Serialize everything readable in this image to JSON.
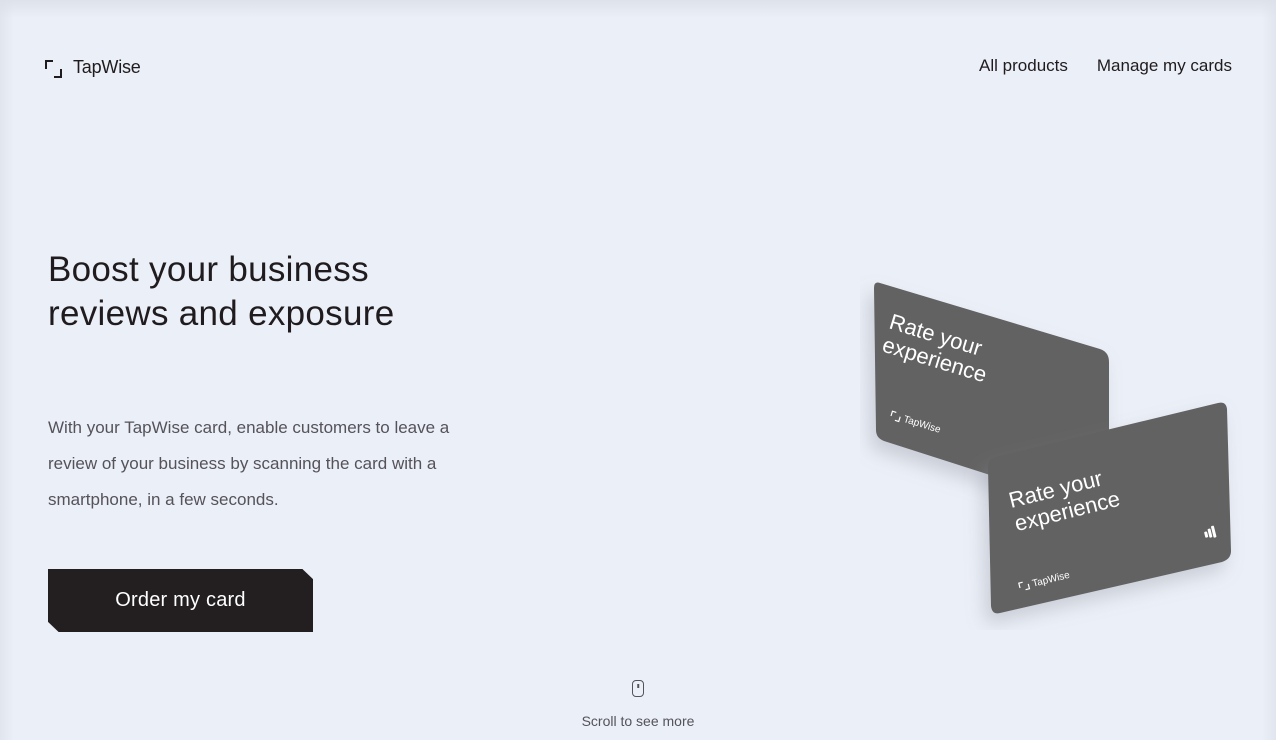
{
  "header": {
    "logo_text": "TapWise",
    "nav": [
      {
        "label": "All products"
      },
      {
        "label": "Manage my cards"
      }
    ]
  },
  "hero": {
    "title": "Boost your business reviews and exposure",
    "description": "With your TapWise card, enable customers to leave a review of your business by scanning the card with a smartphone, in a few seconds.",
    "cta_label": "Order my card"
  },
  "cards": {
    "card_headline_line1": "Rate your",
    "card_headline_line2": "experience",
    "card_brand": "TapWise",
    "card_color": "#626262",
    "card_text_color": "#ffffff"
  },
  "scroll_hint": {
    "icon": "mouse-icon",
    "label": "Scroll to see more"
  },
  "colors": {
    "background": "#ebeff7",
    "text": "#1f1b1e",
    "muted_text": "#55525a",
    "button": "#231f21"
  }
}
